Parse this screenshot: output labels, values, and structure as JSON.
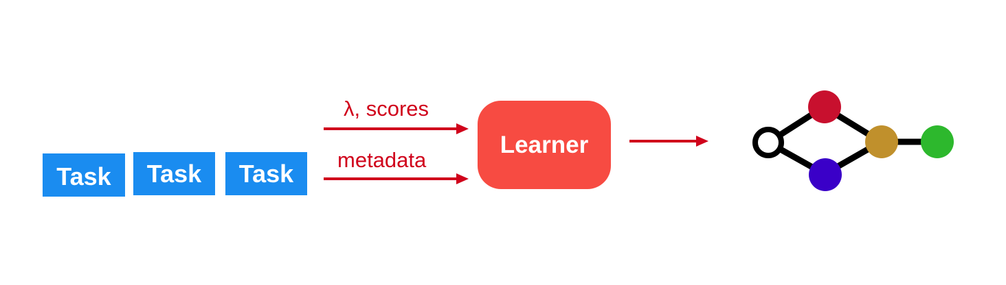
{
  "tasks": [
    {
      "label": "Task"
    },
    {
      "label": "Task"
    },
    {
      "label": "Task"
    }
  ],
  "edges": {
    "top_label": "λ, scores",
    "bottom_label": "metadata"
  },
  "learner": {
    "label": "Learner"
  },
  "graph": {
    "nodes": [
      {
        "name": "input-node",
        "color": "#ffffff",
        "stroke": "#000000"
      },
      {
        "name": "top-node",
        "color": "#c8102e"
      },
      {
        "name": "bottom-node",
        "color": "#3a00c8"
      },
      {
        "name": "merge-node",
        "color": "#c0902c"
      },
      {
        "name": "output-node",
        "color": "#2db82d"
      }
    ]
  },
  "colors": {
    "task": "#1a8cf0",
    "learner": "#f74b42",
    "arrow": "#d0021b"
  }
}
